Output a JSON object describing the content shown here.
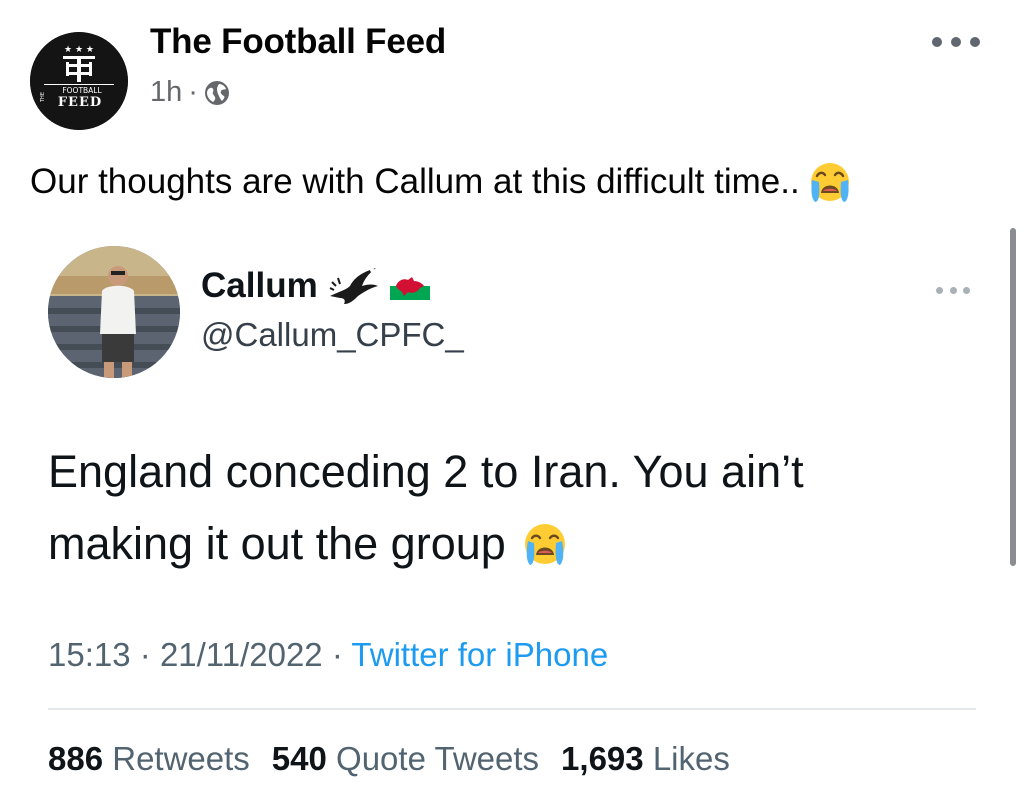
{
  "post": {
    "page_name": "The Football Feed",
    "logo_text_top": "FOOTBALL",
    "logo_text_main": "FEED",
    "logo_text_side": "THE",
    "time": "1h",
    "separator": "·",
    "privacy_icon": "globe-icon",
    "more_icon": "more-horizontal-icon",
    "caption": "Our thoughts are with Callum at this difficult time..",
    "caption_emoji": "loudly-crying-face-icon"
  },
  "tweet": {
    "display_name": "Callum",
    "name_icons": [
      "eagle-icon",
      "wales-flag-icon"
    ],
    "handle": "@Callum_CPFC_",
    "text_line1": "England conceding 2 to Iran. You ain’t",
    "text_line2": "making it out the group",
    "text_emoji": "loudly-crying-face-icon",
    "time": "15:13",
    "date": "21/11/2022",
    "meta_separator": "·",
    "source": "Twitter for iPhone",
    "retweets_count": "886",
    "retweets_label": "Retweets",
    "quotes_count": "540",
    "quotes_label": "Quote Tweets",
    "likes_count": "1,693",
    "likes_label": "Likes"
  },
  "colors": {
    "text": "#050505",
    "secondary": "#65676b",
    "twitter_blue": "#1d9bf0",
    "divider": "#e6e9ec"
  }
}
